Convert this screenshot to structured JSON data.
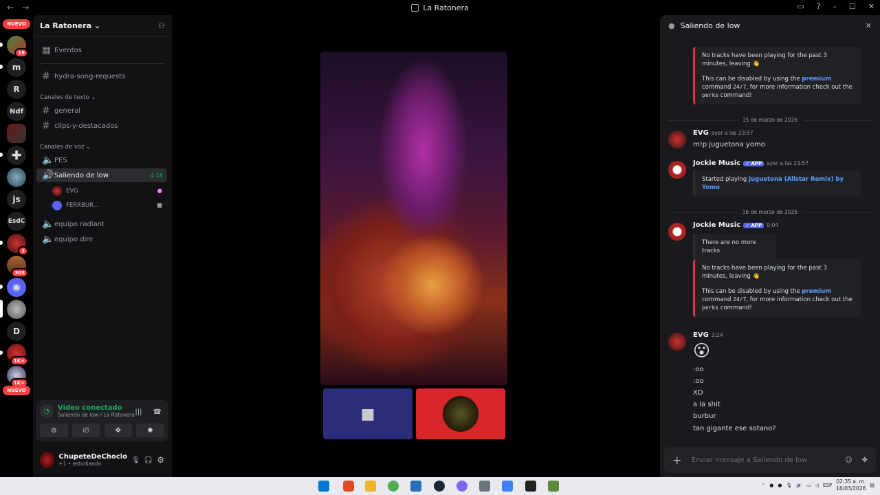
{
  "window": {
    "title": "La Ratonera"
  },
  "servers": {
    "nuevo_top": "NUEVO",
    "nuevo_bottom": "NUEVO",
    "items": [
      {
        "label": "",
        "badge": "19"
      },
      {
        "label": "m",
        "badge": ""
      },
      {
        "label": "R",
        "badge": ""
      },
      {
        "label": "Ndf",
        "badge": ""
      },
      {
        "label": "",
        "badge": ""
      },
      {
        "label": "",
        "badge": ""
      },
      {
        "label": "",
        "badge": ""
      },
      {
        "label": "js",
        "badge": ""
      },
      {
        "label": "EsdC",
        "badge": ""
      },
      {
        "label": "",
        "badge": "2"
      },
      {
        "label": "",
        "badge": "305"
      },
      {
        "label": "",
        "badge": ""
      },
      {
        "label": "",
        "badge": ""
      },
      {
        "label": "D",
        "badge": ""
      },
      {
        "label": "",
        "badge": "1K+"
      },
      {
        "label": "",
        "badge": "1K+"
      }
    ]
  },
  "guild": {
    "name": "La Ratonera"
  },
  "channels": {
    "events": "Eventos",
    "top_channel": "hydra-song-requests",
    "text_category": "Canales de texto",
    "text": [
      "general",
      "clips-y-destacados"
    ],
    "voice_category": "Canales de voz",
    "voice": [
      "PES",
      "Saliendo de low",
      "equipo radiant",
      "equipo dire"
    ],
    "active_timer": "4:18",
    "voice_users": [
      "EVG",
      "FERRBUR..."
    ]
  },
  "voice_panel": {
    "status": "Video conectado",
    "sub": "Saliendo de low / La Ratonera"
  },
  "user": {
    "name": "ChupeteDeChoclo",
    "status": "estudiando",
    "extra": "+1"
  },
  "side": {
    "header": "Saliendo de low",
    "embed1": {
      "line1": "No tracks have been playing for the past 3 minutes, leaving 👋",
      "line2_a": "This can be disabled by using the",
      "line2_b": "premium",
      "line2_c": "command",
      "line2_code": "24/7",
      "line2_d": ", for more information check out the",
      "line2_code2": "perks",
      "line2_e": "command!"
    },
    "date1": "15 de marzo de 2026",
    "msg1": {
      "author": "EVG",
      "time": "ayer a las 23:57",
      "text": "m!p juguetona yomo"
    },
    "msg2": {
      "author": "Jockie Music",
      "tag": "✓ APP",
      "time": "ayer a las 23:57",
      "started": "Started playing",
      "track": "Juguetona (Allstar Remix) by Yomo"
    },
    "date2": "16 de marzo de 2026",
    "msg3": {
      "author": "Jockie Music",
      "tag": "✓ APP",
      "time": "0:04",
      "text": "There are no more tracks"
    },
    "embed2": {
      "line1": "No tracks have been playing for the past 3 minutes, leaving 👋",
      "line2_a": "This can be disabled by using the",
      "line2_b": "premium",
      "line2_c": "command",
      "line2_code": "24/7",
      "line2_d": ", for more information check out the",
      "line2_code2": "perks",
      "line2_e": "command!"
    },
    "msg4": {
      "author": "EVG",
      "time": "2:24",
      "emoji": "😮",
      "lines": [
        ":oo",
        ":oo",
        "XD",
        "a la shit",
        "burbur",
        "tan gigante ese sotano?"
      ]
    },
    "composer_placeholder": "Enviar mensaje a Saliendo de low"
  },
  "taskbar": {
    "lang": "ESP",
    "time": "02:35 a. m.",
    "date": "16/03/2026"
  }
}
